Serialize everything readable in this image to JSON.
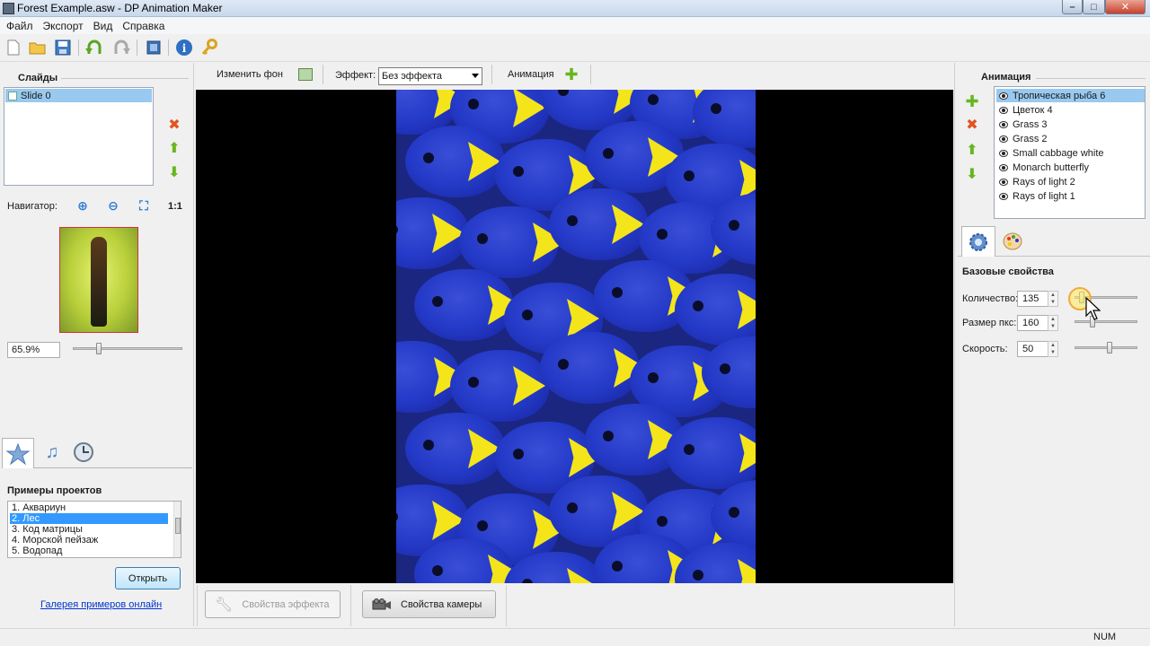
{
  "window": {
    "title": "Forest Example.asw - DP Animation Maker",
    "controls": {
      "minimize": "–",
      "maximize": "□",
      "close": "✕"
    }
  },
  "menu": [
    "Файл",
    "Экспорт",
    "Вид",
    "Справка"
  ],
  "toolbar": {
    "icons": [
      "new-document-icon",
      "open-folder-icon",
      "save-icon",
      "undo-icon",
      "redo-icon",
      "film-icon",
      "info-icon",
      "key-icon"
    ]
  },
  "slides_panel": {
    "title": "Слайды",
    "items": [
      "Slide 0"
    ],
    "navigator_label": "Навигатор:",
    "zoom_fit_label": "1:1",
    "zoom_value": "65.9%",
    "zoom_slider_fraction": 0.24
  },
  "bottom_left": {
    "examples_title": "Примеры проектов",
    "examples": [
      "1. Аквариун",
      "2. Лес",
      "3. Код матрицы",
      "4. Морской пейзаж",
      "5. Водопад"
    ],
    "selected_index": 1,
    "open_button": "Открыть",
    "gallery_link": "Галерея примеров онлайн"
  },
  "center_toolbar": {
    "change_bg": "Изменить фон",
    "effect_label": "Эффект:",
    "effect_value": "Без эффекта",
    "animation_label": "Анимация"
  },
  "bottom_buttons": {
    "effect_props": "Свойства эффекта",
    "camera_props": "Свойства камеры"
  },
  "animation_panel": {
    "title": "Анимация",
    "items": [
      "Тропическая рыба 6",
      "Цветок 4",
      "Grass 3",
      "Grass 2",
      "Small cabbage white",
      "Monarch butterfly",
      "Rays of light 2",
      "Rays of light 1"
    ],
    "selected_index": 0
  },
  "properties": {
    "title": "Базовые свойства",
    "fields": [
      {
        "label": "Количество:",
        "value": "135",
        "slider_fraction": 0.12
      },
      {
        "label": "Размер пкс:",
        "value": "160",
        "slider_fraction": 0.28
      },
      {
        "label": "Скорость:",
        "value": "50",
        "slider_fraction": 0.55
      }
    ]
  },
  "status": {
    "num": "NUM"
  },
  "colors": {
    "selection": "#99c9ef",
    "list_selection": "#3399ff",
    "fish_body": "#243ac8",
    "fish_fin": "#f4e51b"
  }
}
